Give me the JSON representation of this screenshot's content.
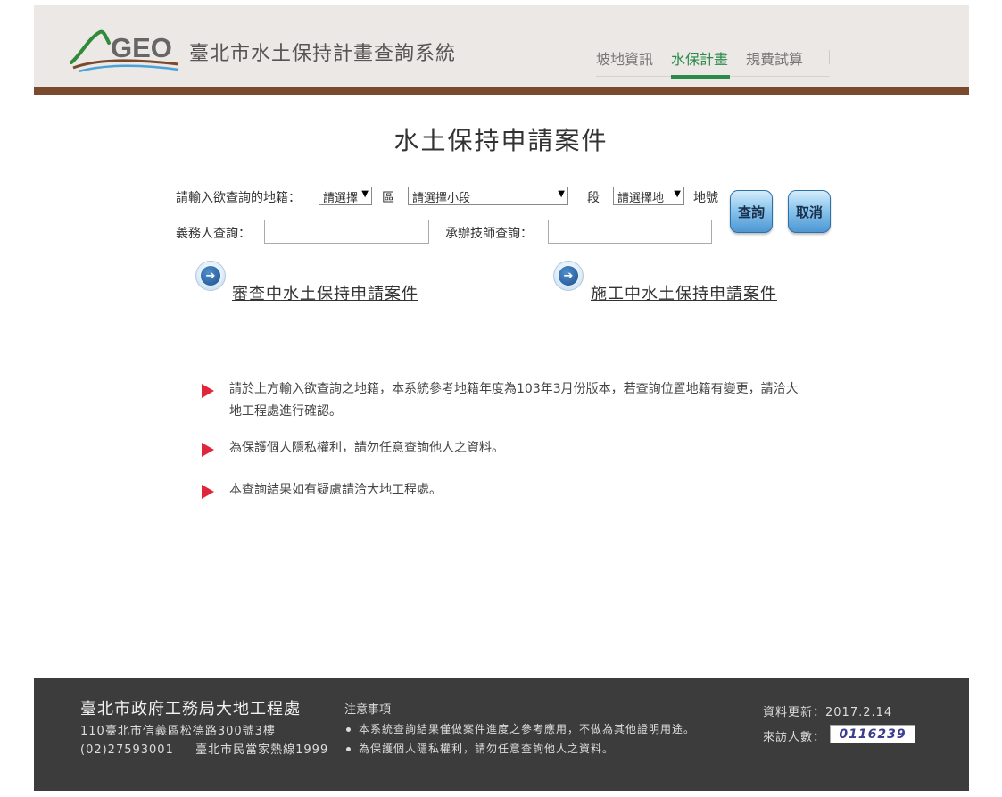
{
  "header": {
    "logo_text": "GEO",
    "site_title": "臺北市水土保持計畫查詢系統",
    "nav": [
      {
        "label": "坡地資訊"
      },
      {
        "label": "水保計畫"
      },
      {
        "label": "規費試算"
      }
    ],
    "active_nav": "水保計畫"
  },
  "main": {
    "title": "水土保持申請案件",
    "form": {
      "cadastre_label": "請輸入欲查詢的地籍：",
      "district_select": "請選擇",
      "district_unit": "區",
      "subsection_select": "請選擇小段",
      "section_unit": "段",
      "lot_select": "請選擇地",
      "lot_unit": "地號",
      "obligor_label": "義務人查詢：",
      "obligor_value": "",
      "engineer_label": "承辦技師查詢：",
      "engineer_value": "",
      "search_button": "查詢",
      "cancel_button": "取消"
    },
    "links": {
      "review": "審查中水土保持申請案件",
      "construction": "施工中水土保持申請案件"
    },
    "notes": [
      "請於上方輸入欲查詢之地籍，本系統參考地籍年度為103年3月份版本，若查詢位置地籍有變更，請洽大地工程處進行確認。",
      "為保護個人隱私權利，請勿任意查詢他人之資料。",
      "本查詢結果如有疑慮請洽大地工程處。"
    ]
  },
  "footer": {
    "org": "臺北市政府工務局大地工程處",
    "address": "110臺北市信義區松德路300號3樓",
    "phone": "(02)27593001",
    "hotline": "臺北市民當家熱線1999",
    "notes_title": "注意事項",
    "notes": [
      "本系統查詢結果僅做案件進度之參考應用，不做為其他證明用途。",
      "為保護個人隱私權利，請勿任意查詢他人之資料。"
    ],
    "update_label": "資料更新：",
    "update_date": "2017.2.14",
    "visitor_label": "來訪人數：",
    "visitor_count": "0116239"
  },
  "colors": {
    "accent_green": "#2a8a4a",
    "header_bar_brown": "#7b4a2e",
    "note_arrow_red": "#e0263a",
    "footer_bg": "#3c3c3c"
  }
}
